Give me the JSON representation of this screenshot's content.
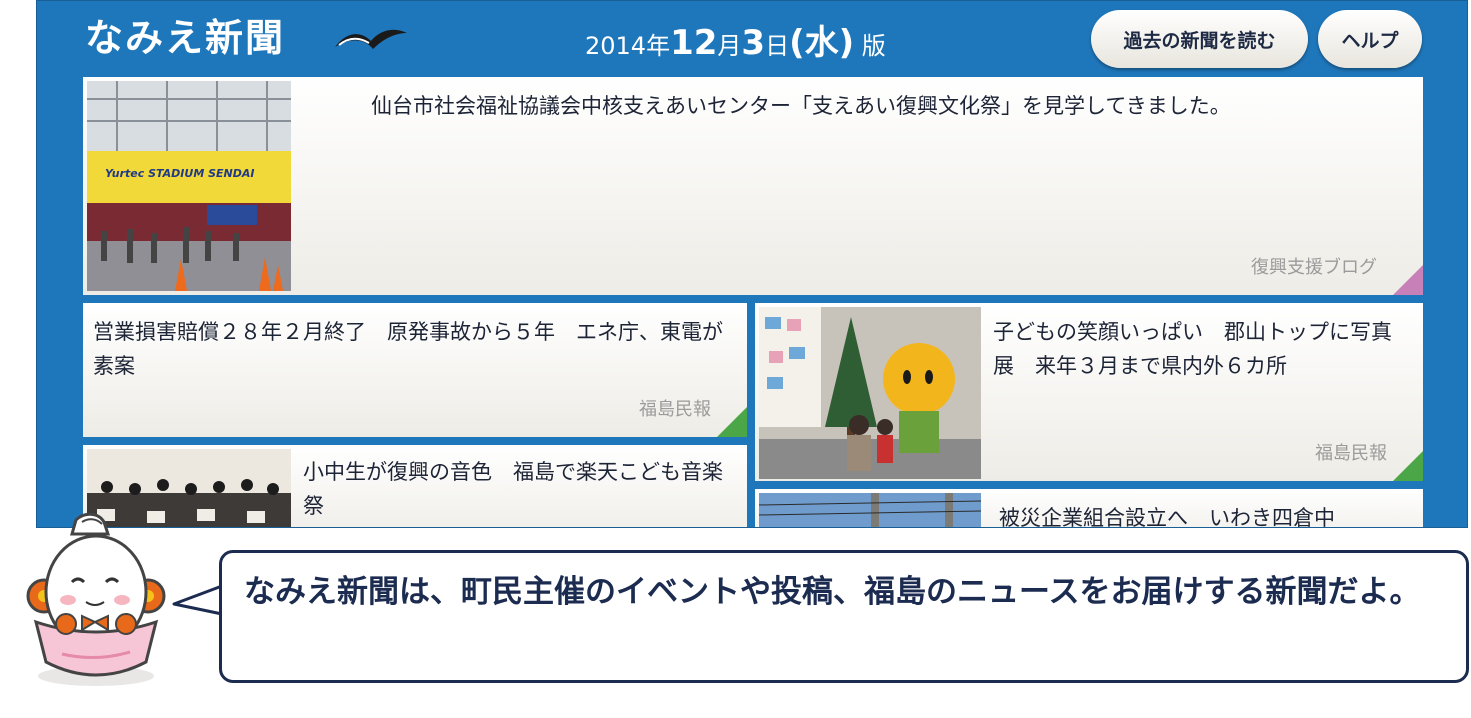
{
  "header": {
    "logo_text": "なみえ新聞",
    "date": {
      "year": "2014",
      "year_suffix": "年",
      "month": "12",
      "month_suffix": "月",
      "day": "3",
      "day_suffix": "日",
      "weekday": "(水)",
      "edition": " 版"
    },
    "past_button": "過去の新聞を読む",
    "help_button": "ヘルプ"
  },
  "articles": [
    {
      "headline": "仙台市社会福祉協議会中核支えあいセンター「支えあい復興文化祭」を見学してきました。",
      "source": "復興支援ブログ",
      "thumb_sign": "Yurtec STADIUM SENDAI"
    },
    {
      "headline": "営業損害賠償２８年２月終了　原発事故から５年　エネ庁、東電が素案",
      "source": "福島民報"
    },
    {
      "headline": "子どもの笑顔いっぱい　郡山トップに写真展　来年３月まで県内外６カ所",
      "source": "福島民報"
    },
    {
      "headline": "小中生が復興の音色　福島で楽天こども音楽祭"
    },
    {
      "headline": "被災企業組合設立へ　いわき四倉中"
    }
  ],
  "message": "なみえ新聞は、町民主催のイベントや投稿、福島のニュースをお届けする新聞だよ。",
  "colors": {
    "accent": "#1f77bb",
    "source_marker_green": "#4aa647",
    "source_marker_pink": "#c880b9",
    "text_dark": "#1c2b50"
  }
}
